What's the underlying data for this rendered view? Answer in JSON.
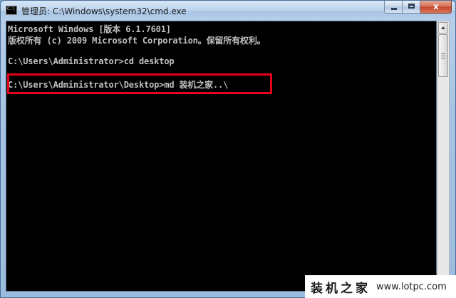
{
  "window": {
    "title": "管理员: C:\\Windows\\system32\\cmd.exe",
    "close_glyph": "x"
  },
  "console": {
    "lines": [
      "Microsoft Windows [版本 6.1.7601]",
      "版权所有 (c) 2009 Microsoft Corporation。保留所有权利。",
      "C:\\Users\\Administrator>cd desktop",
      "C:\\Users\\Administrator\\Desktop>md 装机之家..\\"
    ]
  },
  "highlight": {
    "color": "#e8001a"
  },
  "watermark": {
    "brand": "装机之家",
    "url": "www.lotpc.com"
  },
  "icons": [
    "cmd-app-icon",
    "minimize-icon",
    "maximize-icon",
    "close-icon",
    "scroll-up-arrow-icon",
    "scroll-down-arrow-icon"
  ]
}
